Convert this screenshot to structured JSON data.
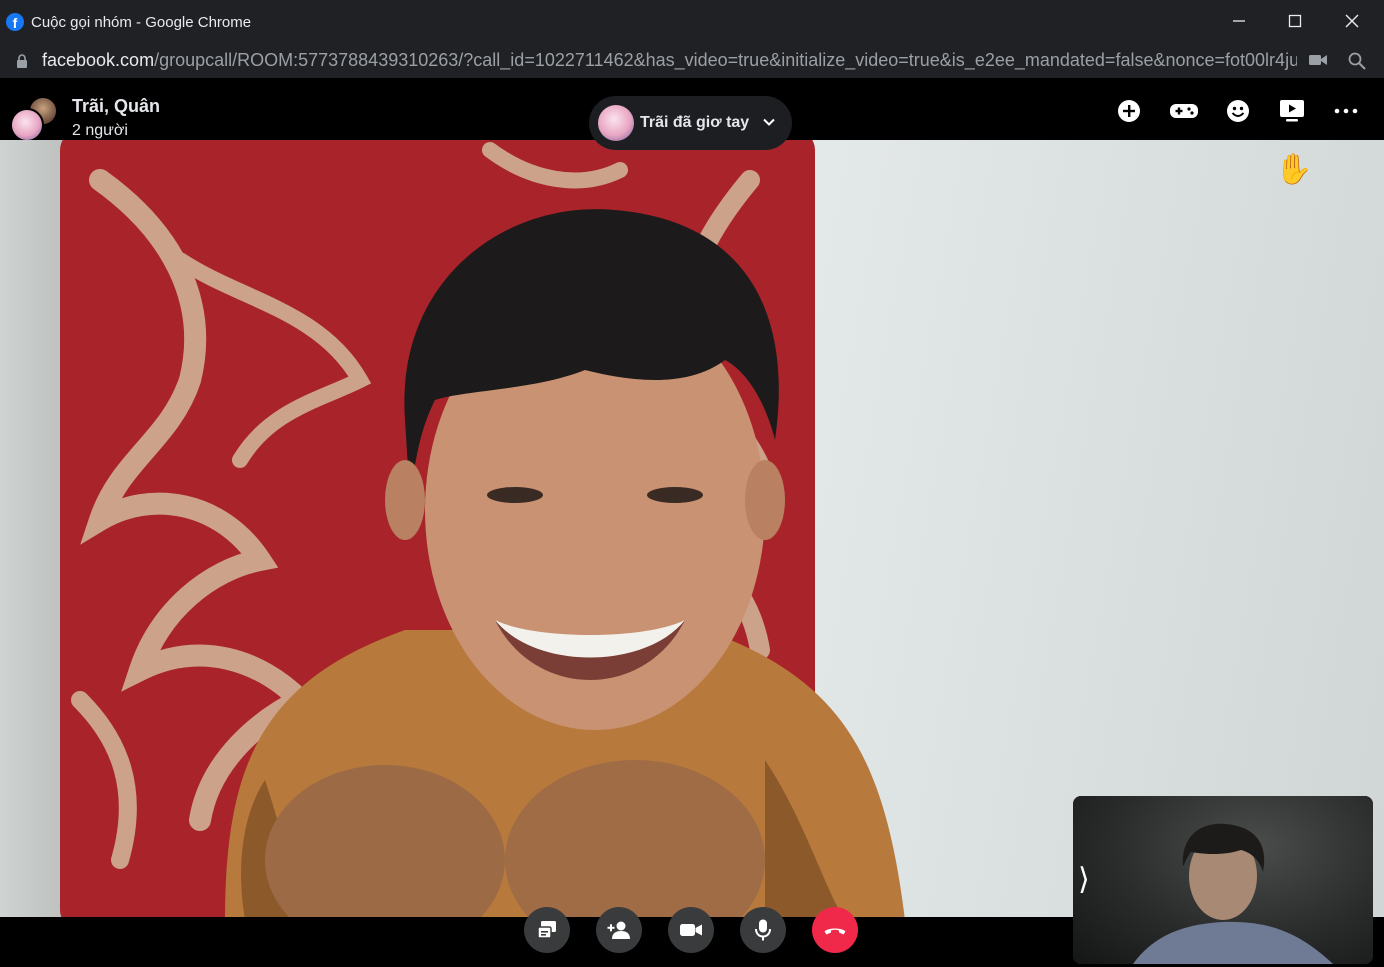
{
  "window": {
    "title": "Cuộc gọi nhóm - Google Chrome",
    "url_host": "facebook.com",
    "url_path": "/groupcall/ROOM:5773788439310263/?call_id=1022711462&has_video=true&initialize_video=true&is_e2ee_mandated=false&nonce=fot00lr4jula..."
  },
  "call": {
    "group_name": "Trãi, Quân",
    "participant_count": "2 người",
    "raise_hand_notice": "Trãi đã giơ tay",
    "raised_hand_emoji": "✋"
  },
  "header_actions": [
    "add-icon",
    "game-controller-icon",
    "emoji-icon",
    "share-screen-icon",
    "more-icon"
  ],
  "controls": [
    "screen-share-icon",
    "add-person-icon",
    "camera-icon",
    "microphone-icon",
    "end-call-icon"
  ],
  "self_view": {
    "expand_glyph": "⟩"
  },
  "colors": {
    "end_call": "#f02849",
    "control_bg": "#3a3b3c",
    "header_bg": "#000000"
  }
}
